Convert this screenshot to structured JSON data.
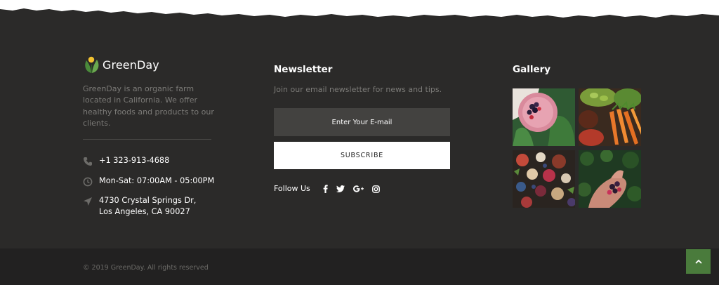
{
  "brand": {
    "name": "GreenDay",
    "logo_icon": "leaf-logo-icon"
  },
  "about": {
    "text": "GreenDay is an organic farm located in California. We offer healthy foods and products to our clients."
  },
  "contact": {
    "phone": "+1 323-913-4688",
    "hours": "Mon-Sat: 07:00AM - 05:00PM",
    "address_line1": "4730 Crystal Springs Dr,",
    "address_line2": "Los Angeles, CA 90027"
  },
  "newsletter": {
    "title": "Newsletter",
    "description": "Join our email newsletter for news and tips.",
    "email_placeholder": "Enter Your E-mail",
    "subscribe_label": "SUBSCRIBE"
  },
  "follow": {
    "label": "Follow Us",
    "networks": [
      "facebook-icon",
      "twitter-icon",
      "google-plus-icon",
      "instagram-icon"
    ]
  },
  "gallery": {
    "title": "Gallery",
    "images": [
      "berry-smoothie",
      "vegetable-bowls",
      "fruit-mix",
      "berries-in-hand"
    ]
  },
  "footer": {
    "copyright": "© 2019 GreenDay. All rights reserved"
  },
  "colors": {
    "footer_bg": "#2b2a29",
    "bottom_bg": "#222121",
    "accent_green": "#4a7b3c",
    "muted_text": "#7c7b78",
    "input_bg": "#434240"
  }
}
